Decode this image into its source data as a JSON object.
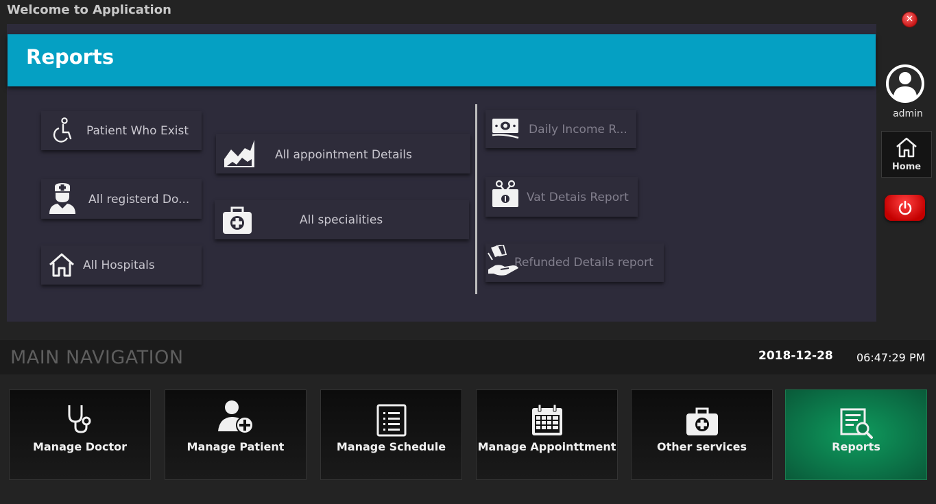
{
  "window": {
    "title": "Welcome to Application",
    "close_icon": "close-icon"
  },
  "page": {
    "title": "Reports"
  },
  "reports": {
    "left": [
      {
        "label": "Patient Who Exist",
        "icon": "wheelchair-icon"
      },
      {
        "label": "All registerd Do...",
        "icon": "doctor-icon"
      },
      {
        "label": "All Hospitals",
        "icon": "house-icon"
      }
    ],
    "middle": [
      {
        "label": "All appointment Details",
        "icon": "area-chart-icon"
      },
      {
        "label": "All specialities",
        "icon": "medical-kit-icon"
      }
    ],
    "right": [
      {
        "label": "Daily Income R...",
        "icon": "banknote-icon"
      },
      {
        "label": "Vat Detais Report",
        "icon": "tax-receipt-icon"
      },
      {
        "label": "Refunded Details report",
        "icon": "refund-hand-icon"
      }
    ]
  },
  "sidebar": {
    "user": "admin",
    "home_label": "Home",
    "power_icon": "power-icon"
  },
  "nav": {
    "title": "MAIN NAVIGATION",
    "date": "2018-12-28",
    "time": "06:47:29 PM",
    "tiles": [
      {
        "label": "Manage Doctor",
        "icon": "stethoscope-icon"
      },
      {
        "label": "Manage Patient",
        "icon": "add-user-icon"
      },
      {
        "label": "Manage Schedule",
        "icon": "list-icon"
      },
      {
        "label": "Manage Appointtment",
        "icon": "calendar-icon"
      },
      {
        "label": "Other services",
        "icon": "medical-kit-icon"
      },
      {
        "label": "Reports",
        "icon": "report-search-icon"
      }
    ],
    "active_color": "#0f9c5e"
  },
  "colors": {
    "banner": "#05a0c3",
    "panel": "#2d2b3a",
    "background": "#232323"
  }
}
